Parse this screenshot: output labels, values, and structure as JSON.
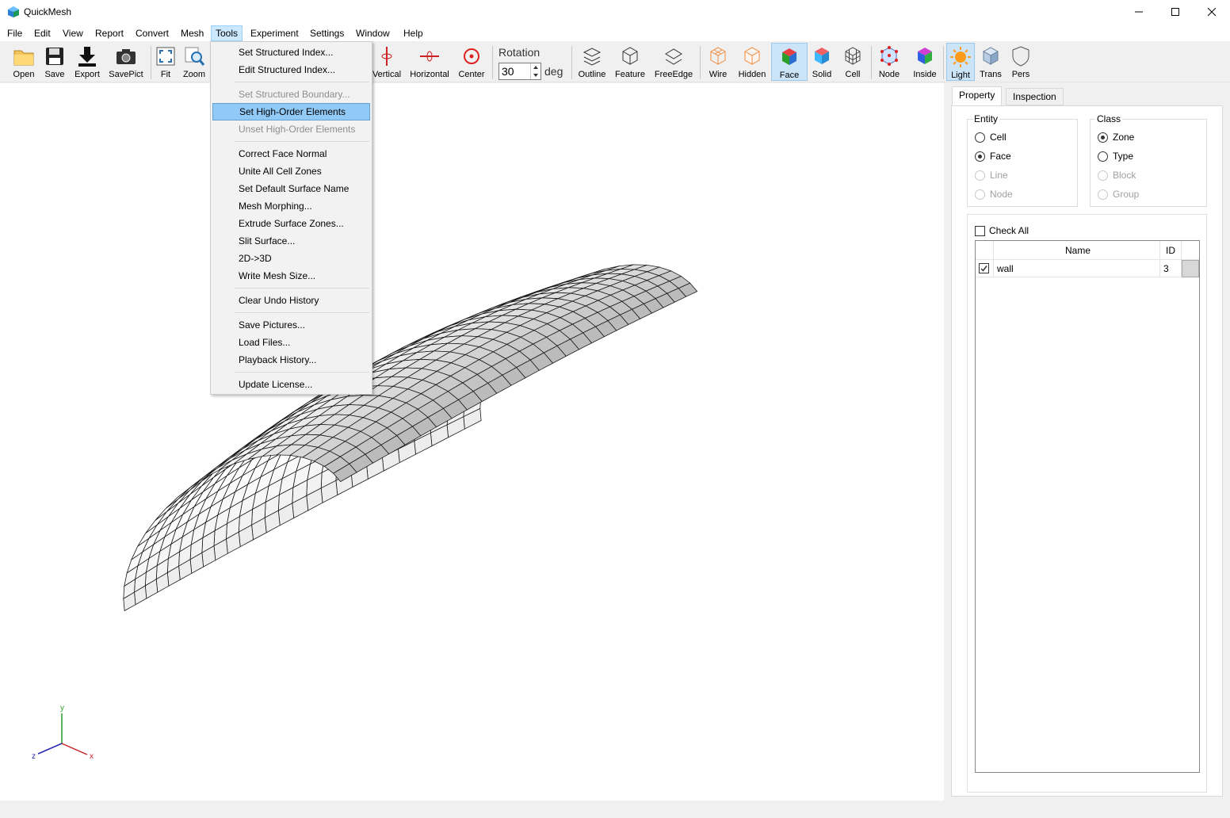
{
  "window": {
    "title": "QuickMesh"
  },
  "menubar": [
    "File",
    "Edit",
    "View",
    "Report",
    "Convert",
    "Mesh",
    "Tools",
    "Experiment",
    "Settings",
    "Window",
    "Help"
  ],
  "toolbar": {
    "buttons": [
      "Open",
      "Save",
      "Export",
      "SavePict",
      "Fit",
      "Zoom",
      "Vertical",
      "Horizontal",
      "Center",
      "Outline",
      "Feature",
      "FreeEdge",
      "Wire",
      "Hidden",
      "Face",
      "Solid",
      "Cell",
      "Node",
      "Inside",
      "Light",
      "Trans",
      "Pers"
    ],
    "rotation_label": "Rotation",
    "rotation_value": "30",
    "rotation_unit": "deg",
    "pressed": [
      "Face",
      "Light"
    ]
  },
  "tools_menu": {
    "items": [
      {
        "label": "Set Structured Index...",
        "enabled": true
      },
      {
        "label": "Edit Structured Index...",
        "enabled": true
      },
      {
        "label": "Set Structured Boundary...",
        "enabled": false
      },
      {
        "label": "Set High-Order Elements",
        "enabled": true,
        "highlighted": true
      },
      {
        "label": "Unset High-Order Elements",
        "enabled": false
      },
      {
        "label": "Correct Face Normal",
        "enabled": true
      },
      {
        "label": "Unite All Cell Zones",
        "enabled": true
      },
      {
        "label": "Set Default Surface Name",
        "enabled": true
      },
      {
        "label": "Mesh Morphing...",
        "enabled": true
      },
      {
        "label": "Extrude Surface Zones...",
        "enabled": true
      },
      {
        "label": "Slit Surface...",
        "enabled": true
      },
      {
        "label": "2D->3D",
        "enabled": true
      },
      {
        "label": "Write Mesh Size...",
        "enabled": true
      },
      {
        "label": "Clear Undo History",
        "enabled": true
      },
      {
        "label": "Save Pictures...",
        "enabled": true
      },
      {
        "label": "Load Files...",
        "enabled": true
      },
      {
        "label": "Playback History...",
        "enabled": true
      },
      {
        "label": "Update License...",
        "enabled": true
      }
    ]
  },
  "panel": {
    "tabs": [
      "Property",
      "Inspection"
    ],
    "active_tab": "Property",
    "entity": {
      "title": "Entity",
      "options": [
        {
          "label": "Cell",
          "checked": false,
          "enabled": true
        },
        {
          "label": "Face",
          "checked": true,
          "enabled": true
        },
        {
          "label": "Line",
          "checked": false,
          "enabled": false
        },
        {
          "label": "Node",
          "checked": false,
          "enabled": false
        }
      ]
    },
    "class": {
      "title": "Class",
      "options": [
        {
          "label": "Zone",
          "checked": true,
          "enabled": true
        },
        {
          "label": "Type",
          "checked": false,
          "enabled": true
        },
        {
          "label": "Block",
          "checked": false,
          "enabled": false
        },
        {
          "label": "Group",
          "checked": false,
          "enabled": false
        }
      ]
    },
    "check_all": {
      "label": "Check All",
      "checked": false
    },
    "table": {
      "columns": [
        "Name",
        "ID"
      ],
      "rows": [
        {
          "checked": true,
          "name": "wall",
          "id": "3"
        }
      ]
    }
  },
  "axes": {
    "x": "x",
    "y": "y",
    "z": "z"
  },
  "colors": {
    "accent": "#cce8ff",
    "menu_highlight": "#91c9f7",
    "mesh_face": "#f0f0f0"
  }
}
